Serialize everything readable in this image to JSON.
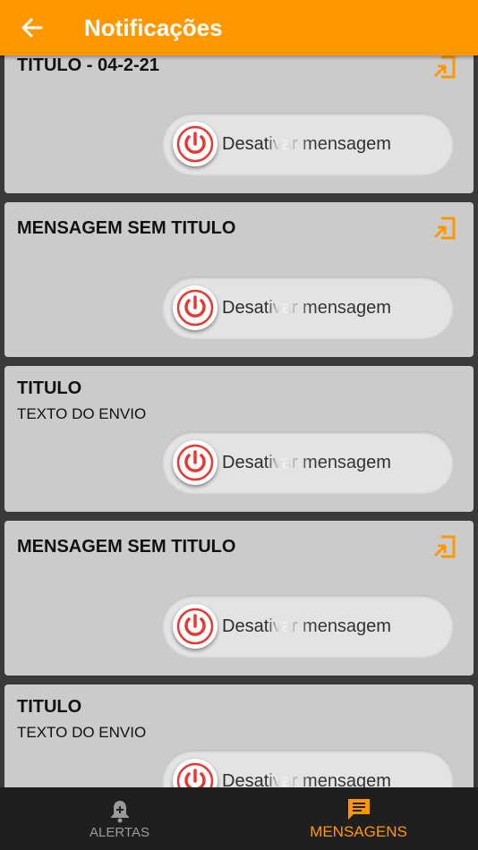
{
  "appbar": {
    "title": "Notificações",
    "back_icon": "arrow-left-icon"
  },
  "colors": {
    "accent": "#ff9800",
    "card": "#cbcbcb",
    "power_red": "#e53935"
  },
  "cards": [
    {
      "title": "TITULO - 04-2-21",
      "subtitle": "",
      "has_open_icon": true,
      "toggle_label": "Desativar mensagem"
    },
    {
      "title": "MENSAGEM SEM TITULO",
      "subtitle": "",
      "has_open_icon": true,
      "toggle_label": "Desativar mensagem"
    },
    {
      "title": "TITULO",
      "subtitle": "TEXTO DO ENVIO",
      "has_open_icon": false,
      "toggle_label": "Desativar mensagem"
    },
    {
      "title": "MENSAGEM SEM TITULO",
      "subtitle": "",
      "has_open_icon": true,
      "toggle_label": "Desativar mensagem"
    },
    {
      "title": "TITULO",
      "subtitle": "TEXTO DO ENVIO",
      "has_open_icon": false,
      "toggle_label": "Desativar mensagem"
    }
  ],
  "bottom_nav": [
    {
      "label": "ALERTAS",
      "icon": "bell-alert-icon",
      "active": false
    },
    {
      "label": "MENSAGENS",
      "icon": "message-icon",
      "active": true
    }
  ]
}
